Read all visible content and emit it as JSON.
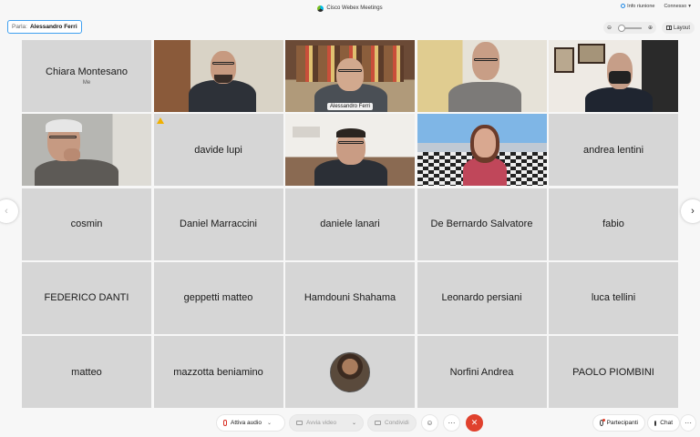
{
  "app": {
    "title": "Cisco Webex Meetings",
    "info": "Info riunione",
    "status": "Connesso"
  },
  "speaking": {
    "label": "Parla:",
    "name": "Alessandro Ferri"
  },
  "layout_label": "Layout",
  "tiles": [
    {
      "name": "Chiara Montesano",
      "sub": "Me"
    },
    {
      "name": ""
    },
    {
      "name": "",
      "overlay": "Alessandro Ferri"
    },
    {
      "name": ""
    },
    {
      "name": ""
    },
    {
      "name": ""
    },
    {
      "name": "davide lupi"
    },
    {
      "name": ""
    },
    {
      "name": ""
    },
    {
      "name": "andrea lentini"
    },
    {
      "name": "cosmin"
    },
    {
      "name": "Daniel Marraccini"
    },
    {
      "name": "daniele lanari"
    },
    {
      "name": "De Bernardo Salvatore"
    },
    {
      "name": "fabio"
    },
    {
      "name": "FEDERICO DANTI"
    },
    {
      "name": "geppetti matteo"
    },
    {
      "name": "Hamdouni Shahama"
    },
    {
      "name": "Leonardo persiani"
    },
    {
      "name": "luca tellini"
    },
    {
      "name": "matteo"
    },
    {
      "name": "mazzotta beniamino"
    },
    {
      "name": ""
    },
    {
      "name": "Norfini Andrea"
    },
    {
      "name": "PAOLO PIOMBINI"
    }
  ],
  "toolbar": {
    "audio": "Attiva audio",
    "video": "Avvia video",
    "share": "Condividi",
    "participants": "Partecipanti",
    "chat": "Chat"
  },
  "colors": {
    "accent": "#3fa0f0",
    "end_call": "#e0412d",
    "tile_bg": "#d6d6d6"
  }
}
